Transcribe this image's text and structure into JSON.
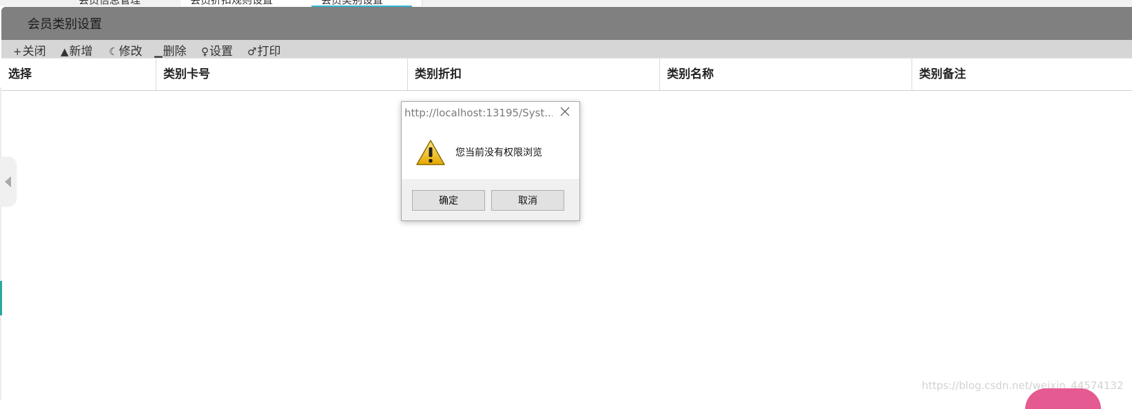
{
  "tabs": [
    {
      "label": "会员信息管理"
    },
    {
      "label": "会员折扣规则设置"
    },
    {
      "label": "会员类别设置"
    }
  ],
  "panel": {
    "title": "会员类别设置"
  },
  "toolbar": {
    "buttons": [
      {
        "glyph": "+",
        "label": "关闭",
        "icon": "close-icon"
      },
      {
        "glyph": "▲",
        "label": "新增",
        "icon": "add-icon"
      },
      {
        "glyph": "☾",
        "label": "修改",
        "icon": "edit-icon"
      },
      {
        "glyph": "▁",
        "label": "删除",
        "icon": "delete-icon"
      },
      {
        "glyph": "♀",
        "label": "设置",
        "icon": "settings-icon"
      },
      {
        "glyph": "♂",
        "label": "打印",
        "icon": "print-icon"
      }
    ]
  },
  "grid": {
    "columns": [
      "选择",
      "类别卡号",
      "类别折扣",
      "类别名称",
      "类别备注"
    ]
  },
  "dialog": {
    "title": "http://localhost:13195/Syst...",
    "message": "您当前没有权限浏览",
    "ok_label": "确定",
    "cancel_label": "取消",
    "icon": "warning-icon"
  },
  "watermark": "https://blog.csdn.net/weixin_44574132",
  "colors": {
    "header_bg": "#808080",
    "toolbar_bg": "#d6d6d6",
    "accent_teal": "#2aa79b",
    "tab_underline": "#35b6d6"
  }
}
